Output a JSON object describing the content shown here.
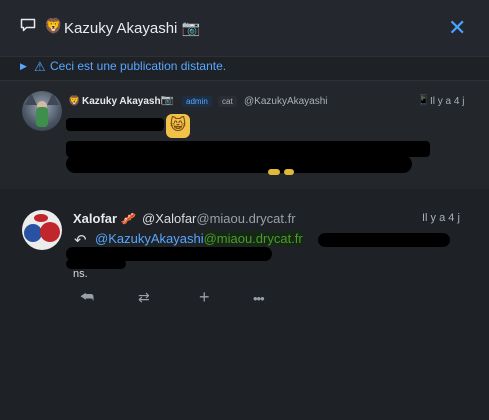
{
  "header": {
    "title_emoji": "🦁",
    "title": "Kazuky Akayashi 📷",
    "close_label": "✕"
  },
  "notice": {
    "text": "Ceci est une publication distante."
  },
  "post1": {
    "emoji": "🦁",
    "name": "Kazuky Akayashi",
    "name_emoji": "📷",
    "badges": [
      "admin",
      "cat"
    ],
    "handle": "@KazukyAkayashi",
    "time": "Il y a 4 j"
  },
  "post2": {
    "name": "Xalofar",
    "name_emoji": "🥓",
    "handle_user": "@Xalofar",
    "handle_host": "@miaou.drycat.fr",
    "time": "Il y a 4 j",
    "mention_user": "@KazukyAkayashi",
    "mention_host": "@miaou.drycat.fr",
    "body_tail": "ns."
  },
  "actions": {
    "reply": "⮪",
    "boost": "⇄",
    "add": "+",
    "more": "•••"
  },
  "colors": {
    "accent": "#58a6ff",
    "background": "#1e2227",
    "panel": "#23272c"
  }
}
